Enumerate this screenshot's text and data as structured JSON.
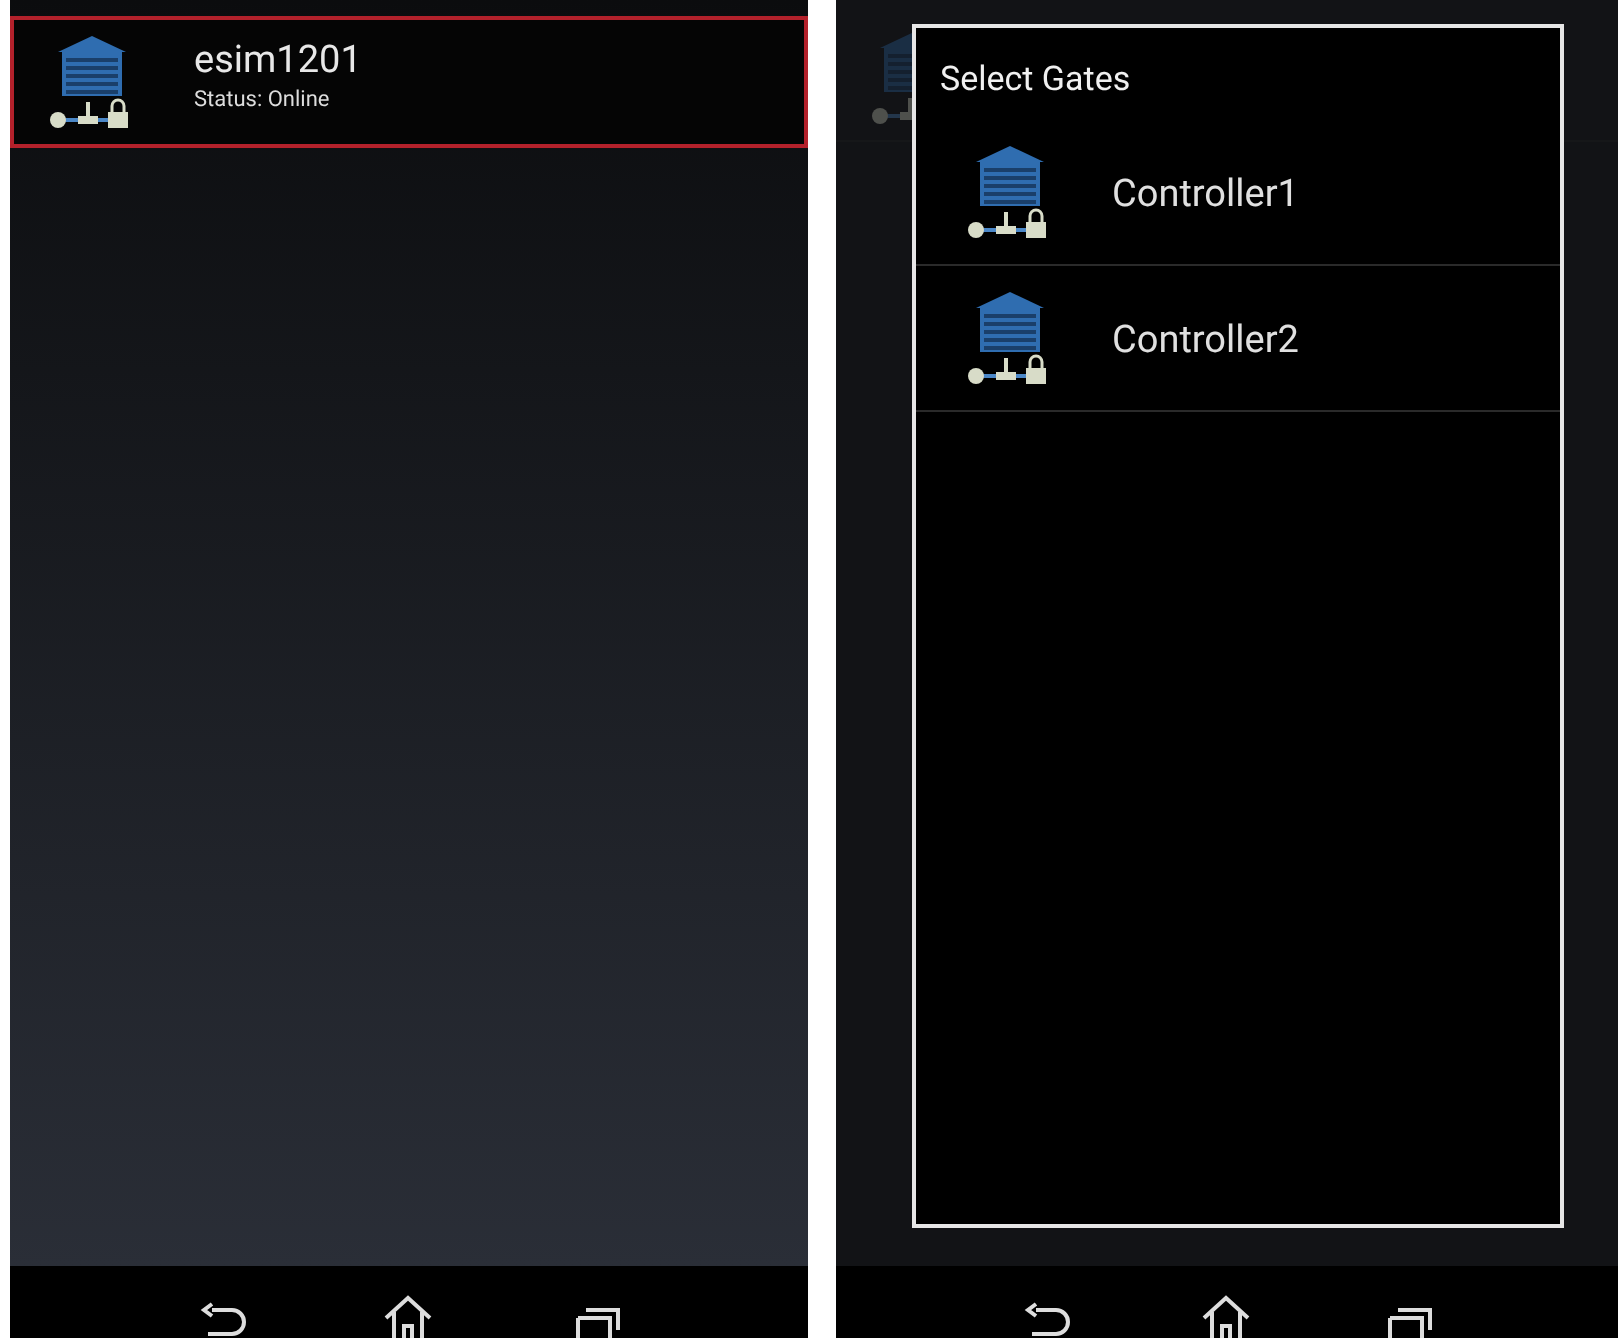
{
  "device_list": {
    "items": [
      {
        "name": "esim1201",
        "status": "Status: Online",
        "selected": true
      }
    ]
  },
  "select_dialog": {
    "title": "Select Gates",
    "items": [
      {
        "name": "Controller1"
      },
      {
        "name": "Controller2"
      }
    ]
  }
}
